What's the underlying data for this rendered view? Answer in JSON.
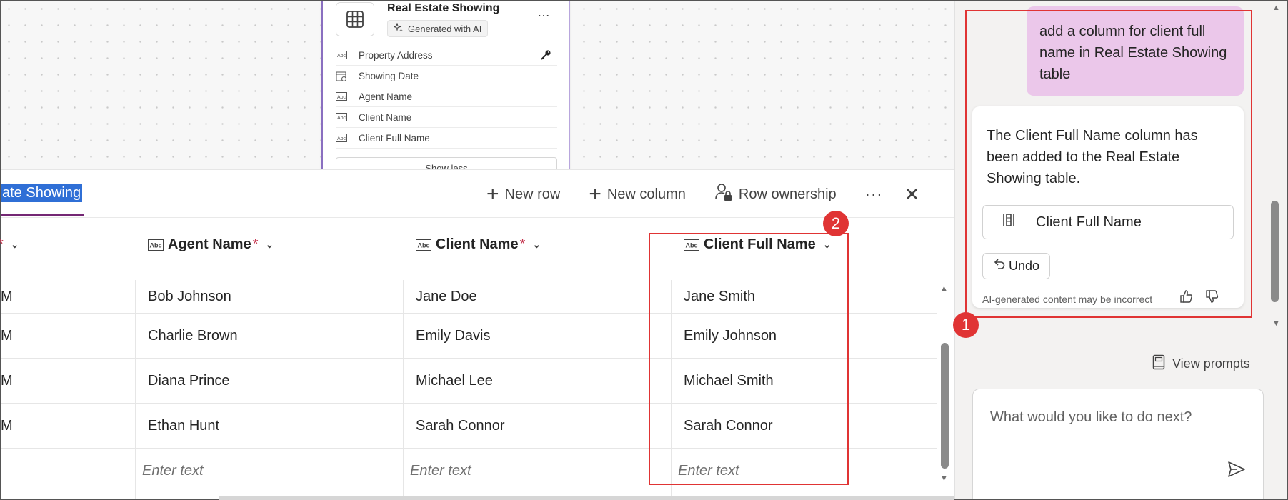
{
  "entity_card": {
    "title": "Real Estate Showing",
    "badge": "Generated with AI",
    "more": "…",
    "fields": [
      {
        "label": "Property Address",
        "icon": "text-field-icon",
        "key": true
      },
      {
        "label": "Showing Date",
        "icon": "date-field-icon",
        "key": false
      },
      {
        "label": "Agent Name",
        "icon": "text-field-icon",
        "key": false
      },
      {
        "label": "Client Name",
        "icon": "text-field-icon",
        "key": false
      },
      {
        "label": "Client Full Name",
        "icon": "text-field-icon",
        "key": false
      }
    ],
    "show_less": "Show less"
  },
  "table": {
    "tab_label": "ate Showing",
    "toolbar": {
      "new_row": "New row",
      "new_column": "New column",
      "row_ownership": "Row ownership",
      "more": "···",
      "close": "✕"
    },
    "columns": [
      {
        "label": "Agent Name",
        "required": "*"
      },
      {
        "label": "Client Name",
        "required": "*"
      },
      {
        "label": "Client Full Name",
        "required": ""
      }
    ],
    "first_col_edge": [
      "M",
      "M",
      "M",
      "M"
    ],
    "rows": [
      {
        "agent": "Bob Johnson",
        "client": "Jane Doe",
        "full": "Jane Smith"
      },
      {
        "agent": "Charlie Brown",
        "client": "Emily Davis",
        "full": "Emily Johnson"
      },
      {
        "agent": "Diana Prince",
        "client": "Michael Lee",
        "full": "Michael Smith"
      },
      {
        "agent": "Ethan Hunt",
        "client": "Sarah Connor",
        "full": "Sarah Connor"
      }
    ],
    "placeholder": "Enter text"
  },
  "annotations": {
    "badge1": "1",
    "badge2": "2"
  },
  "copilot": {
    "user_message": "add a column for client full name in Real Estate Showing table",
    "ai_message": "The Client Full Name column has been added to the Real Estate Showing table.",
    "column_chip": "Client Full Name",
    "undo": "Undo",
    "disclaimer": "AI-generated content may be incorrect",
    "view_prompts": "View prompts",
    "compose_placeholder": "What would you like to do next?"
  },
  "colors": {
    "accent": "#742774",
    "tab_highlight": "#2f6fd6",
    "user_bubble": "#ebc7ea",
    "annotation": "#e03434",
    "required": "#c4314b"
  }
}
